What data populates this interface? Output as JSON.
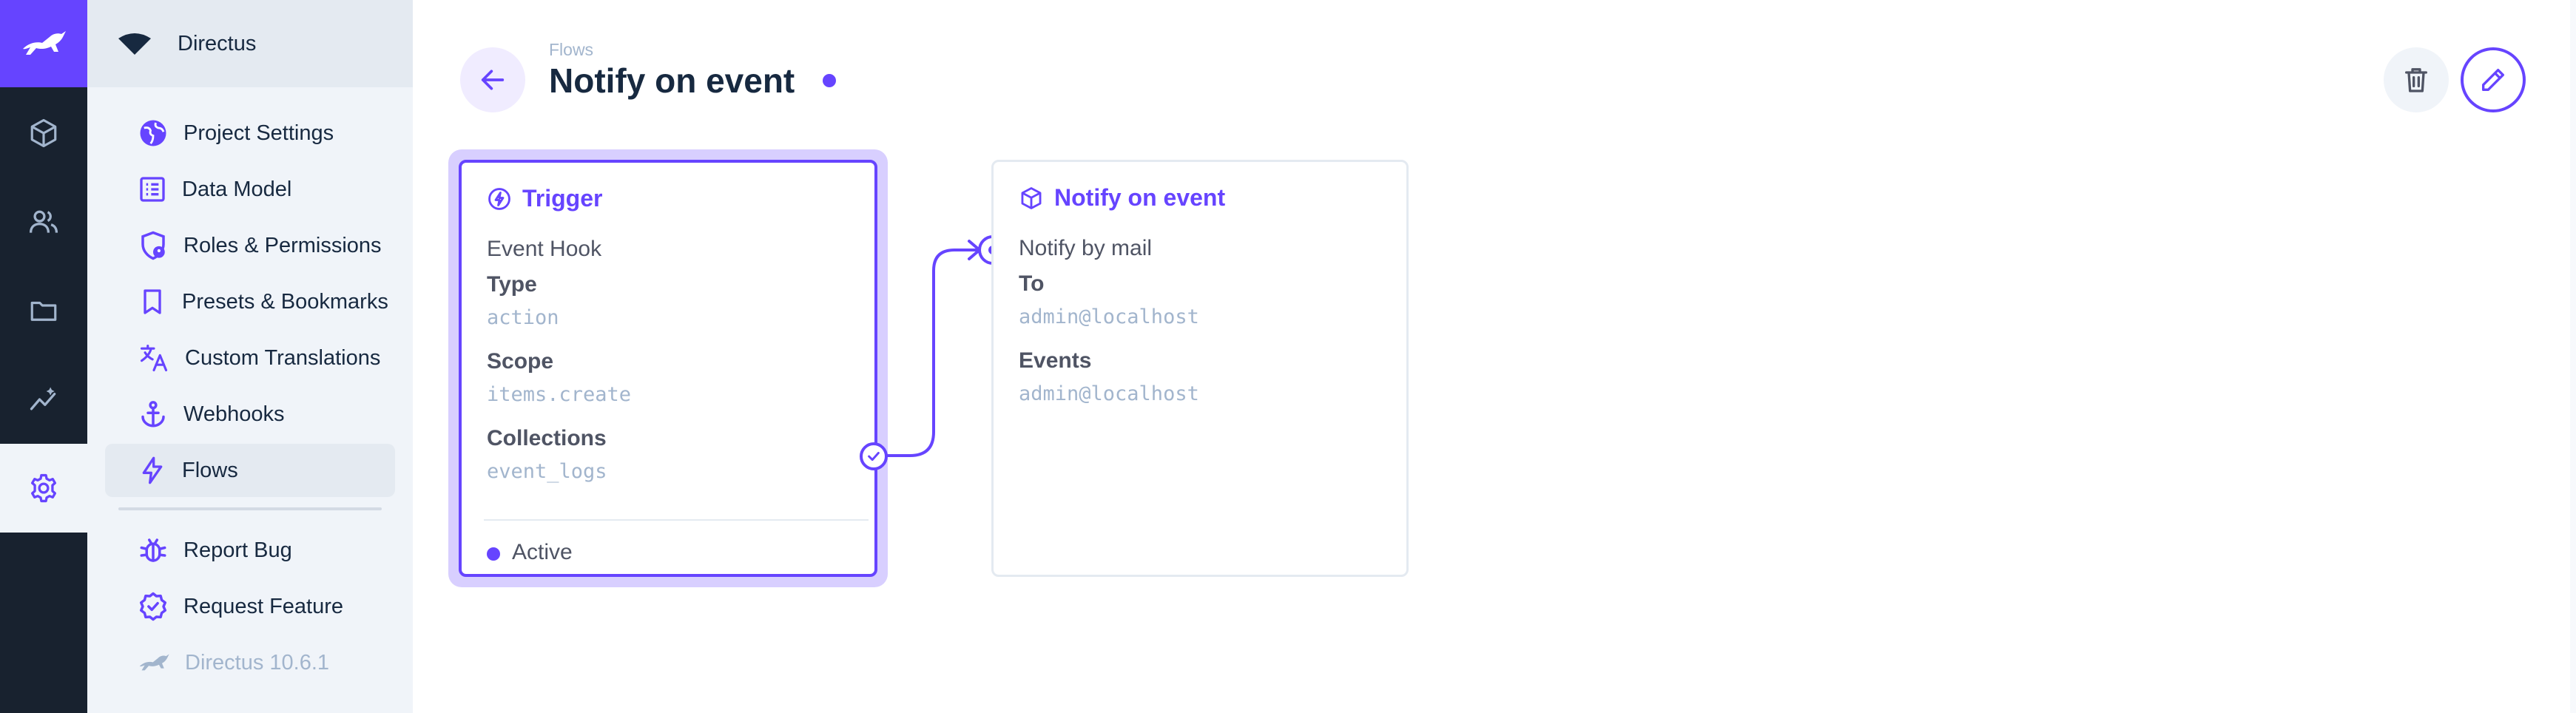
{
  "module_bar": {
    "logo_icon": "rabbit-logo-icon",
    "modules": [
      {
        "icon": "cube-icon",
        "name": "content"
      },
      {
        "icon": "users-icon",
        "name": "users"
      },
      {
        "icon": "folder-icon",
        "name": "files"
      },
      {
        "icon": "insights-icon",
        "name": "insights"
      },
      {
        "icon": "gear-icon",
        "name": "settings",
        "active": true
      }
    ],
    "colors": {
      "background": "#18222f",
      "brand": "#6644ff"
    }
  },
  "navigation": {
    "project_name": "Directus",
    "items": [
      {
        "label": "Project Settings",
        "icon": "globe-icon"
      },
      {
        "label": "Data Model",
        "icon": "list-box-icon"
      },
      {
        "label": "Roles & Permissions",
        "icon": "shield-account-icon"
      },
      {
        "label": "Presets & Bookmarks",
        "icon": "bookmark-icon"
      },
      {
        "label": "Custom Translations",
        "icon": "translate-icon"
      },
      {
        "label": "Webhooks",
        "icon": "anchor-icon"
      },
      {
        "label": "Flows",
        "icon": "bolt-icon",
        "active": true
      }
    ],
    "footer_items": [
      {
        "label": "Report Bug",
        "icon": "bug-icon"
      },
      {
        "label": "Request Feature",
        "icon": "verified-icon"
      }
    ],
    "version": "Directus 10.6.1"
  },
  "header": {
    "breadcrumb": "Flows",
    "title": "Notify on event",
    "back_icon": "arrow-left-icon",
    "delete_icon": "trash-icon",
    "edit_icon": "pencil-icon"
  },
  "trigger": {
    "title": "Trigger",
    "icon": "bolt-circle-icon",
    "kind": "Event Hook",
    "type_label": "Type",
    "type_value": "action",
    "scope_label": "Scope",
    "scope_value": "items.create",
    "collections_label": "Collections",
    "collections_value": "event_logs",
    "status": "Active"
  },
  "operation": {
    "title": "Notify on event",
    "icon": "box-icon",
    "kind": "Notify by mail",
    "to_label": "To",
    "to_value": "admin@localhost",
    "events_label": "Events",
    "events_value": "admin@localhost"
  },
  "accent_color": "#6644ff"
}
